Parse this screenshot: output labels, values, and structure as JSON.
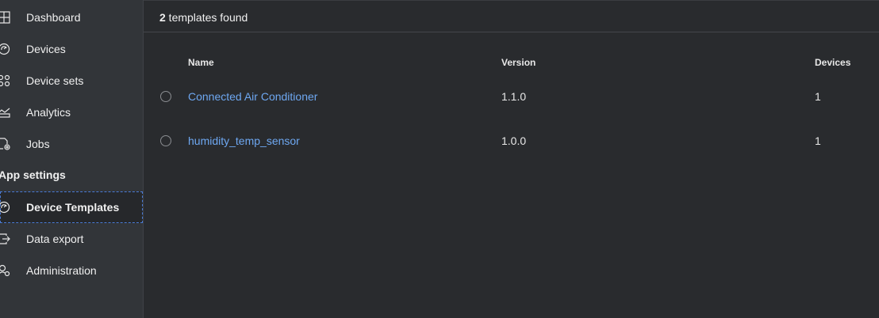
{
  "sidebar": {
    "items": [
      {
        "label": "Dashboard",
        "icon": "dashboard-icon"
      },
      {
        "label": "Devices",
        "icon": "devices-icon"
      },
      {
        "label": "Device sets",
        "icon": "device-sets-icon"
      },
      {
        "label": "Analytics",
        "icon": "analytics-icon"
      },
      {
        "label": "Jobs",
        "icon": "jobs-icon"
      }
    ],
    "section_header": "App settings",
    "settings_items": [
      {
        "label": "Device Templates",
        "icon": "device-templates-icon",
        "selected": true
      },
      {
        "label": "Data export",
        "icon": "data-export-icon"
      },
      {
        "label": "Administration",
        "icon": "administration-icon"
      }
    ]
  },
  "main": {
    "found_count": "2",
    "found_text": " templates found",
    "columns": {
      "name": "Name",
      "version": "Version",
      "devices": "Devices"
    },
    "rows": [
      {
        "name": "Connected Air Conditioner",
        "version": "1.1.0",
        "devices": "1"
      },
      {
        "name": "humidity_temp_sensor",
        "version": "1.0.0",
        "devices": "1"
      }
    ]
  },
  "colors": {
    "sidebar_bg": "#323539",
    "main_bg": "#292b2e",
    "link": "#6ea8f2",
    "focus_outline": "#4a7bd6"
  }
}
